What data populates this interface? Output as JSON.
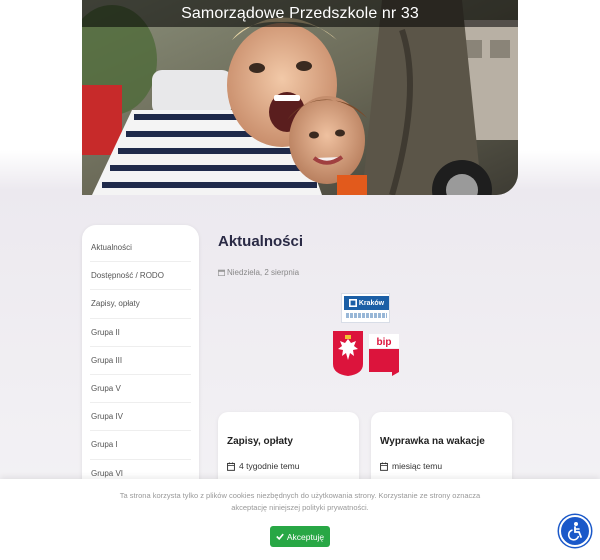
{
  "header": {
    "site_title": "Samorządowe Przedszkole nr 33"
  },
  "sidebar": {
    "items": [
      {
        "label": "Aktualności"
      },
      {
        "label": "Dostępność / RODO"
      },
      {
        "label": "Zapisy, opłaty"
      },
      {
        "label": "Grupa II"
      },
      {
        "label": "Grupa III"
      },
      {
        "label": "Grupa V"
      },
      {
        "label": "Grupa IV"
      },
      {
        "label": "Grupa I"
      },
      {
        "label": "Grupa VI"
      }
    ]
  },
  "main": {
    "title": "Aktualności",
    "date": "Niedziela, 2 sierpnia",
    "logos": {
      "krakow": "Kraków",
      "bip": "bip"
    },
    "cards": [
      {
        "title": "Zapisy, opłaty",
        "meta": "4 tygodnie temu"
      },
      {
        "title": "Wyprawka na wakacje",
        "meta": "miesiąc temu"
      }
    ]
  },
  "cookie": {
    "text": "Ta strona korzysta tylko z plików cookies niezbędnych do użytkowania strony. Korzystanie ze strony oznacza akceptację niniejszej polityki prywatności.",
    "accept_label": "Akceptuję"
  },
  "colors": {
    "accent_green": "#28a745",
    "accessibility_blue": "#1a58c9",
    "title_navy": "#2a2a45",
    "krakow_blue": "#1b5fa6",
    "poland_red": "#dc143c"
  },
  "icons": {
    "calendar": "calendar-icon",
    "check": "check-icon",
    "accessibility": "accessibility-icon"
  }
}
